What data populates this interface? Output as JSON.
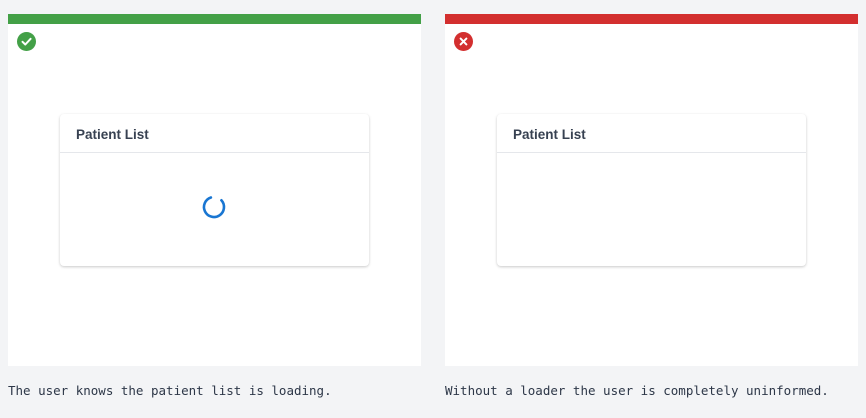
{
  "examples": [
    {
      "kind": "good",
      "status_icon": "check-circle-icon",
      "accent_color": "#43a047",
      "card_title": "Patient List",
      "shows_spinner": true,
      "caption": "The user knows the patient list is loading."
    },
    {
      "kind": "bad",
      "status_icon": "x-circle-icon",
      "accent_color": "#d32f2f",
      "card_title": "Patient List",
      "shows_spinner": false,
      "caption": "Without a loader the user is completely uninformed."
    }
  ],
  "colors": {
    "spinner": "#1976d2",
    "background": "#f3f4f6"
  }
}
